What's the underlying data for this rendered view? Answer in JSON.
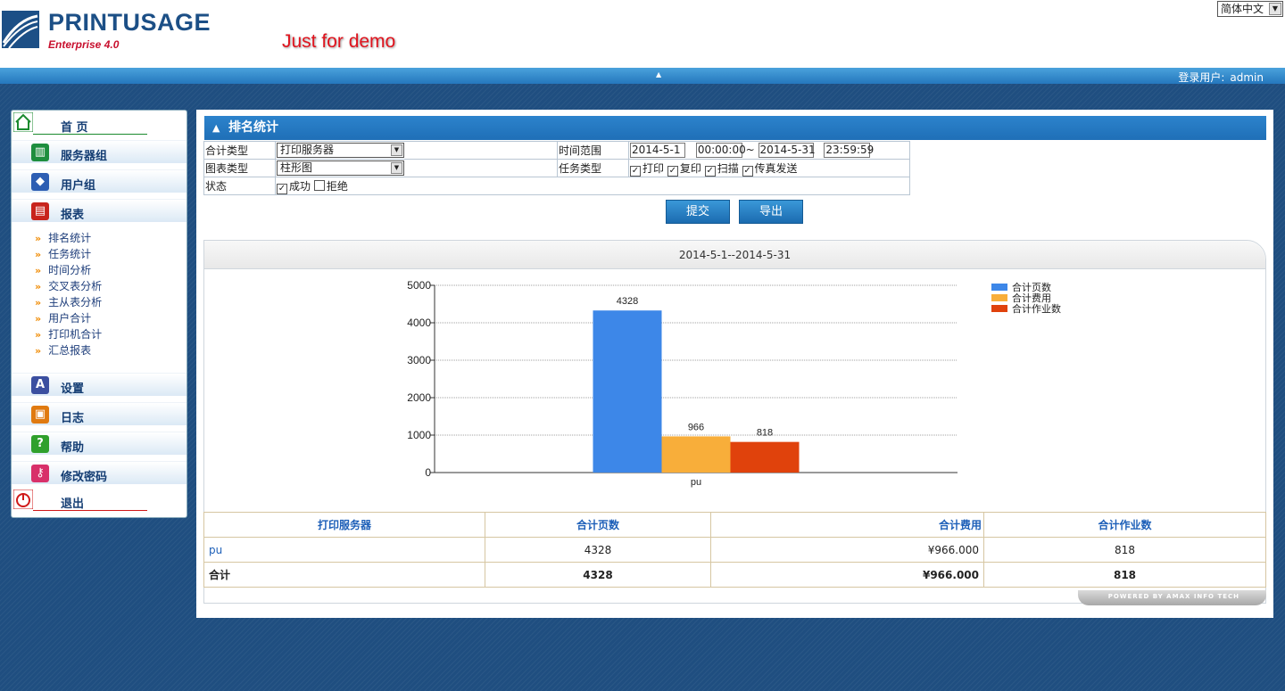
{
  "header": {
    "logo_text": "PRINTUSAGE",
    "logo_sub": "Enterprise 4.0",
    "demo_text": "Just for demo",
    "language": "简体中文",
    "user_label": "登录用户:",
    "username": "admin"
  },
  "sidebar": {
    "home": "首 页",
    "server_group": "服务器组",
    "user_group": "用户组",
    "reports": "报表",
    "report_items": [
      "排名统计",
      "任务统计",
      "时间分析",
      "交叉表分析",
      "主从表分析",
      "用户合计",
      "打印机合计",
      "汇总报表"
    ],
    "settings": "设置",
    "log": "日志",
    "help": "帮助",
    "change_password": "修改密码",
    "logout": "退出"
  },
  "page": {
    "title": "排名统计",
    "filters": {
      "total_type_label": "合计类型",
      "total_type_value": "打印服务器",
      "chart_type_label": "图表类型",
      "chart_type_value": "柱形图",
      "status_label": "状态",
      "status_success": "成功",
      "status_rejected": "拒绝",
      "time_range_label": "时间范围",
      "date_from": "2014-5-1",
      "time_from": "00:00:00",
      "tilde": "~",
      "date_to": "2014-5-31",
      "time_to": "23:59:59",
      "job_type_label": "任务类型",
      "job_print": "打印",
      "job_copy": "复印",
      "job_scan": "扫描",
      "job_fax": "传真发送"
    },
    "checks": {
      "success": true,
      "rejected": false,
      "print": true,
      "copy": true,
      "scan": true,
      "fax": true
    },
    "submit_label": "提交",
    "export_label": "导出",
    "chart_header": "2014-5-1--2014-5-31",
    "powered": "POWERED BY AMAX INFO TECH"
  },
  "chart_data": {
    "type": "bar",
    "categories": [
      "pu"
    ],
    "series": [
      {
        "name": "合计页数",
        "values": [
          4328
        ],
        "color": "#3d87e8"
      },
      {
        "name": "合计费用",
        "values": [
          966
        ],
        "color": "#f8ae3a"
      },
      {
        "name": "合计作业数",
        "values": [
          818
        ],
        "color": "#e0420c"
      }
    ],
    "ylim": [
      0,
      5000
    ],
    "yticks": [
      0,
      1000,
      2000,
      3000,
      4000,
      5000
    ],
    "grid": true,
    "legend": "top-right"
  },
  "table": {
    "headers": [
      "打印服务器",
      "合计页数",
      "合计费用",
      "合计作业数"
    ],
    "rows": [
      {
        "name": "pu",
        "pages": "4328",
        "cost": "¥966.000",
        "jobs": "818"
      }
    ],
    "total": {
      "name": "合计",
      "pages": "4328",
      "cost": "¥966.000",
      "jobs": "818"
    }
  }
}
